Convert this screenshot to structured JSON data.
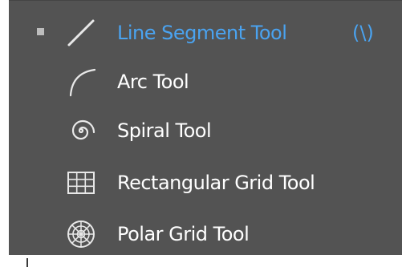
{
  "flyout": {
    "items": [
      {
        "label": "Line Segment Tool",
        "shortcut": "(\\)",
        "icon": "line-segment-icon",
        "active": true
      },
      {
        "label": "Arc Tool",
        "icon": "arc-icon"
      },
      {
        "label": "Spiral Tool",
        "icon": "spiral-icon"
      },
      {
        "label": "Rectangular Grid Tool",
        "icon": "rectangular-grid-icon"
      },
      {
        "label": "Polar Grid Tool",
        "icon": "polar-grid-icon"
      }
    ],
    "colors": {
      "background": "#535353",
      "active_text": "#4aa3f0",
      "text": "#ffffff"
    }
  }
}
